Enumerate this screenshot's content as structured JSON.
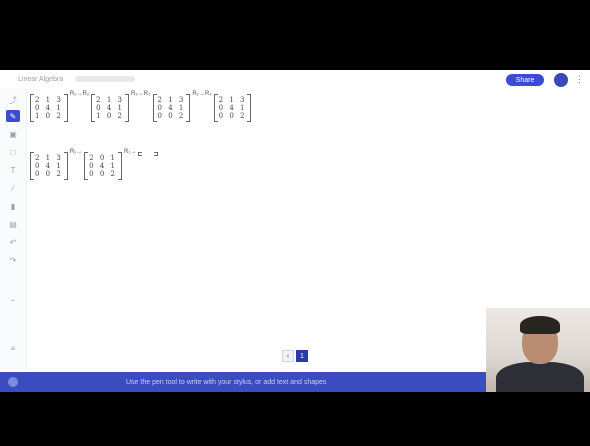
{
  "header": {
    "breadcrumb": "Linear Algebra",
    "share_label": "Share",
    "more_icon": "more-icon"
  },
  "toolbar": {
    "tools": [
      "select-icon",
      "pen-icon",
      "eraser-icon",
      "shape-icon",
      "text-icon",
      "line-icon",
      "highlighter-icon",
      "image-icon",
      "undo-icon",
      "redo-icon",
      "zoom-icon"
    ]
  },
  "canvas": {
    "row1": {
      "m1": [
        "2 1 3",
        "0 4 1",
        "1 0 2"
      ],
      "e1": "R₂→R₂",
      "m2": [
        "2 1 3",
        "0 4 1",
        "1 0 2"
      ],
      "e2": "R₃→R₃",
      "m3": [
        "2 1 3",
        "0 4 1",
        "0 0 2"
      ],
      "e3": "R₂→R₂",
      "m4": [
        "2 1 3",
        "0 4 1",
        "0 0 2"
      ]
    },
    "row2": {
      "m1": [
        "2 1 3",
        "0 4 1",
        "0 0 2"
      ],
      "e1": "R₁→",
      "m2": [
        "2 0 1",
        "0 4 1",
        "0 0 2"
      ],
      "e2": "R₁→",
      "m3": [
        "",
        "",
        ""
      ]
    }
  },
  "pager": {
    "prev": "‹",
    "current": "1"
  },
  "banner": {
    "message": "Use the pen tool to write with your stylus, or add text and shapes"
  },
  "colors": {
    "accent": "#3b4bd6",
    "banner": "#3a4cc0"
  }
}
